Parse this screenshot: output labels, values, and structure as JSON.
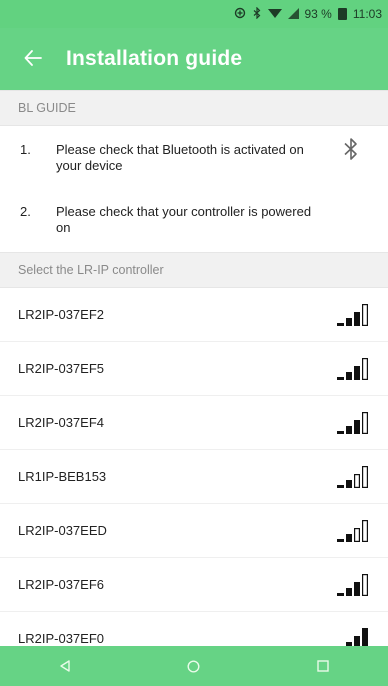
{
  "status_bar": {
    "battery_text": "93 %",
    "time": "11:03"
  },
  "app_bar": {
    "back_icon": "arrow-left-icon",
    "title": "Installation guide"
  },
  "guide_section": {
    "header": "BL GUIDE",
    "steps": [
      {
        "number": "1.",
        "text": "Please check that Bluetooth is activated on your device"
      },
      {
        "number": "2.",
        "text": "Please check that your controller is powered on"
      }
    ]
  },
  "select_section": {
    "header": "Select the LR-IP controller"
  },
  "devices": [
    {
      "name": "LR2IP-037EF2",
      "signal_bars": 3
    },
    {
      "name": "LR2IP-037EF5",
      "signal_bars": 3
    },
    {
      "name": "LR2IP-037EF4",
      "signal_bars": 3
    },
    {
      "name": "LR1IP-BEB153",
      "signal_bars": 2
    },
    {
      "name": "LR2IP-037EED",
      "signal_bars": 2
    },
    {
      "name": "LR2IP-037EF6",
      "signal_bars": 3
    },
    {
      "name": "LR2IP-037EF0",
      "signal_bars": 4
    }
  ],
  "colors": {
    "primary": "#66d385",
    "status_bar": "#62d280",
    "section_bg": "#f1f1f1",
    "text": "#222222",
    "muted": "#8a8a8a"
  }
}
